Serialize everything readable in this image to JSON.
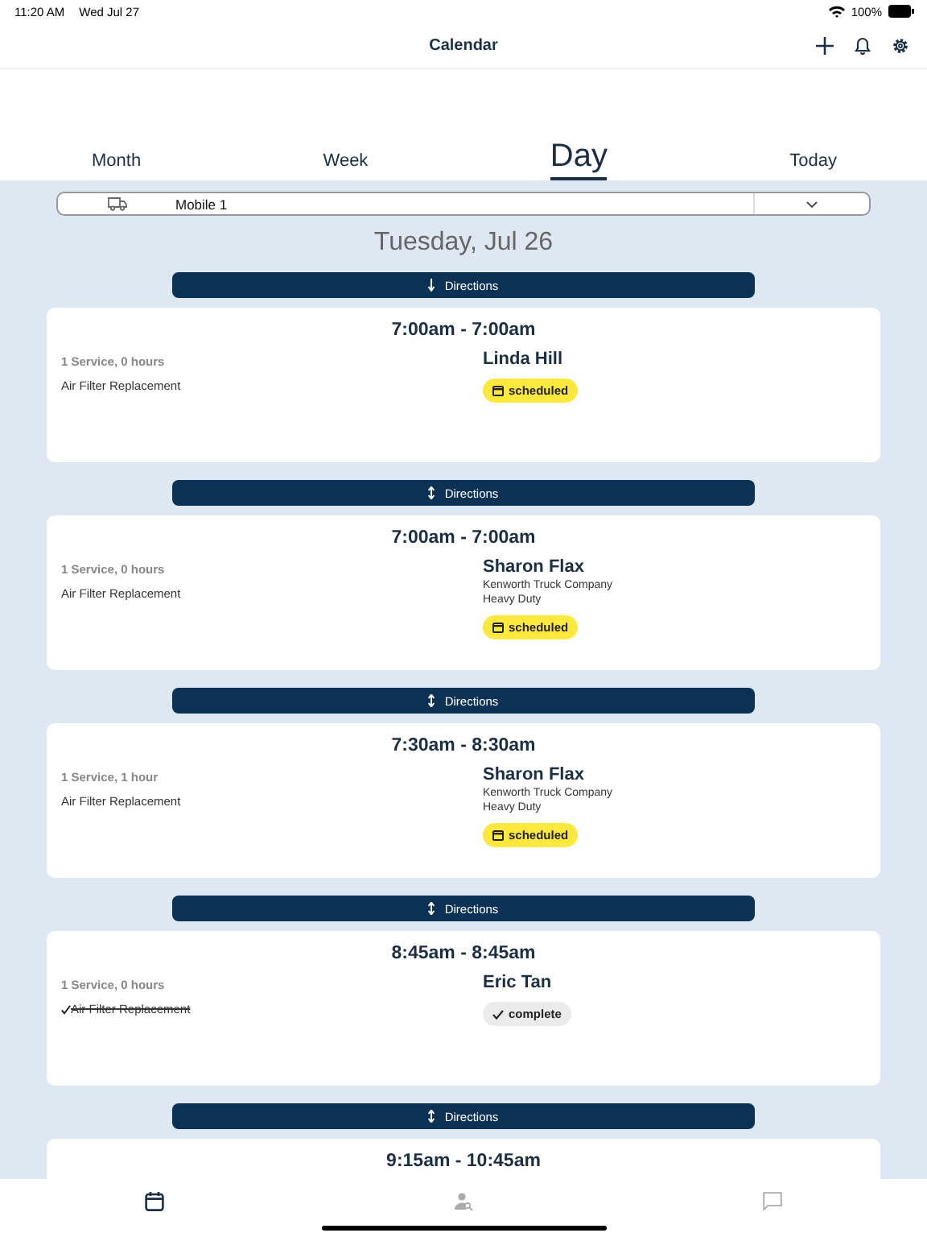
{
  "status_bar": {
    "time": "11:20 AM",
    "date": "Wed Jul 27",
    "battery": "100%"
  },
  "nav": {
    "title": "Calendar"
  },
  "view_tabs": [
    {
      "label": "Month",
      "selected": false
    },
    {
      "label": "Week",
      "selected": false
    },
    {
      "label": "Day",
      "selected": true
    }
  ],
  "today_button": "Today",
  "vehicle_select": {
    "value": "Mobile 1"
  },
  "date_heading": "Tuesday, Jul 26",
  "appointments": [
    {
      "directions": {
        "label": "Directions",
        "kind": "down"
      },
      "time": "7:00am - 7:00am",
      "summary": "1 Service, 0 hours",
      "service": {
        "name": "Air Filter Replacement",
        "done": false
      },
      "customer": "Linda Hill",
      "status": {
        "kind": "scheduled",
        "label": "scheduled"
      }
    },
    {
      "directions": {
        "label": "Directions",
        "kind": "both"
      },
      "time": "7:00am - 7:00am",
      "summary": "1 Service, 0 hours",
      "service": {
        "name": "Air Filter Replacement",
        "done": false
      },
      "customer": "Sharon Flax",
      "details": [
        "Kenworth Truck Company",
        "Heavy Duty"
      ],
      "status": {
        "kind": "scheduled",
        "label": "scheduled"
      }
    },
    {
      "directions": {
        "label": "Directions",
        "kind": "both"
      },
      "time": "7:30am - 8:30am",
      "summary": "1 Service, 1 hour",
      "service": {
        "name": "Air Filter Replacement",
        "done": false
      },
      "customer": "Sharon Flax",
      "details": [
        "Kenworth Truck Company",
        "Heavy Duty"
      ],
      "status": {
        "kind": "scheduled",
        "label": "scheduled"
      }
    },
    {
      "directions": {
        "label": "Directions",
        "kind": "both"
      },
      "time": "8:45am - 8:45am",
      "summary": "1 Service, 0 hours",
      "service": {
        "name": "Air Filter Replacement",
        "done": true
      },
      "customer": "Eric Tan",
      "status": {
        "kind": "complete",
        "label": "complete"
      }
    },
    {
      "directions": {
        "label": "Directions",
        "kind": "both"
      },
      "time": "9:15am - 10:45am"
    }
  ],
  "tab_bar": [
    {
      "kind": "calendar",
      "selected": true
    },
    {
      "kind": "people",
      "selected": false
    },
    {
      "kind": "chat",
      "selected": false
    }
  ]
}
